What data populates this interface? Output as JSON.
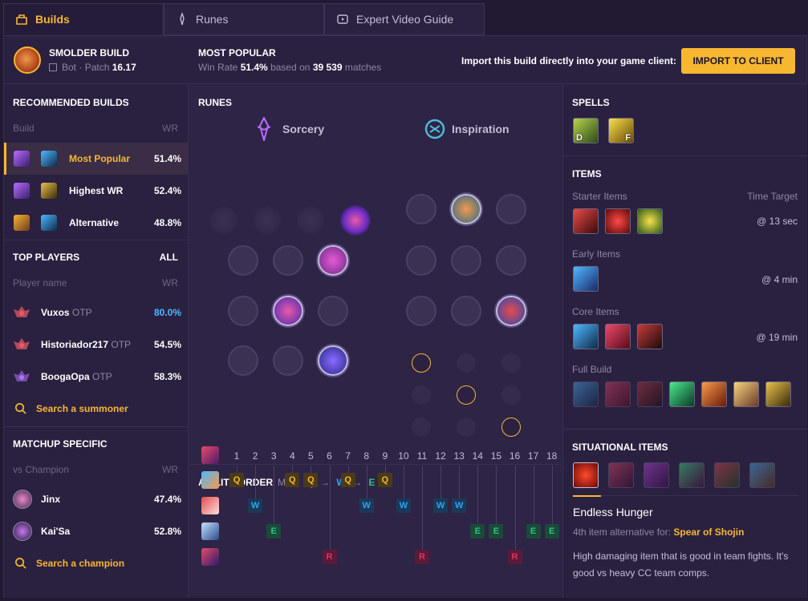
{
  "tabs": [
    {
      "label": "Builds",
      "icon": "builds-icon"
    },
    {
      "label": "Runes",
      "icon": "runes-icon"
    },
    {
      "label": "Expert Video Guide",
      "icon": "video-icon"
    }
  ],
  "header": {
    "champion": "SMOLDER BUILD",
    "role": "Bot",
    "patch_label": "Patch",
    "patch": "16.17",
    "most_popular": "MOST POPULAR",
    "win_rate_label": "Win Rate",
    "win_rate": "51.4%",
    "based_on": "based on",
    "matches": "39 539",
    "matches_label": "matches",
    "import_text": "Import this build directly into your game client:",
    "import_button": "IMPORT TO CLIENT"
  },
  "recommended": {
    "title": "RECOMMENDED BUILDS",
    "col_build": "Build",
    "col_wr": "WR",
    "builds": [
      {
        "name": "Most Popular",
        "wr": "51.4%"
      },
      {
        "name": "Highest WR",
        "wr": "52.4%"
      },
      {
        "name": "Alternative",
        "wr": "48.8%"
      }
    ]
  },
  "top_players": {
    "title": "TOP PLAYERS",
    "all": "ALL",
    "col_name": "Player name",
    "col_wr": "WR",
    "players": [
      {
        "name": "Vuxos",
        "tag": "OTP",
        "wr": "80.0%"
      },
      {
        "name": "Historiador217",
        "tag": "OTP",
        "wr": "54.5%"
      },
      {
        "name": "BoogaOpa",
        "tag": "OTP",
        "wr": "58.3%"
      }
    ],
    "search": "Search a summoner"
  },
  "matchup": {
    "title": "MATCHUP SPECIFIC",
    "col_name": "vs Champion",
    "col_wr": "WR",
    "champions": [
      {
        "name": "Jinx",
        "wr": "47.4%"
      },
      {
        "name": "Kai'Sa",
        "wr": "52.8%"
      }
    ],
    "search": "Search a champion"
  },
  "runes": {
    "title": "RUNES",
    "primary": "Sorcery",
    "secondary": "Inspiration"
  },
  "ability": {
    "title": "ABILITY ORDER",
    "max_label": "Max:",
    "max_order": [
      "Q",
      "W",
      "E"
    ],
    "levels": [
      "1",
      "2",
      "3",
      "4",
      "5",
      "6",
      "7",
      "8",
      "9",
      "10",
      "11",
      "12",
      "13",
      "14",
      "15",
      "16",
      "17",
      "18"
    ],
    "sequence": [
      "Q",
      "W",
      "E",
      "Q",
      "Q",
      "R",
      "Q",
      "W",
      "Q",
      "W",
      "R",
      "W",
      "W",
      "E",
      "E",
      "R",
      "E",
      "E"
    ]
  },
  "spells": {
    "title": "SPELLS",
    "keys": [
      "D",
      "F"
    ]
  },
  "items": {
    "title": "ITEMS",
    "starter": "Starter Items",
    "time_target": "Time Target",
    "starter_time": "@ 13 sec",
    "early": "Early Items",
    "early_time": "@ 4 min",
    "core": "Core Items",
    "core_time": "@ 19 min",
    "full": "Full Build"
  },
  "situational": {
    "title": "SITUATIONAL ITEMS",
    "item_name": "Endless Hunger",
    "alt_label": "4th item alternative for:",
    "alt_item": "Spear of Shojin",
    "desc": "High damaging item that is good in team fights. It's good vs heavy CC team comps."
  },
  "colors": {
    "accent": "#f7b731",
    "q": "#f7b731",
    "w": "#2fa4f0",
    "e": "#2ec27e",
    "r": "#e0345a",
    "wr_high": "#4fb8ff"
  }
}
